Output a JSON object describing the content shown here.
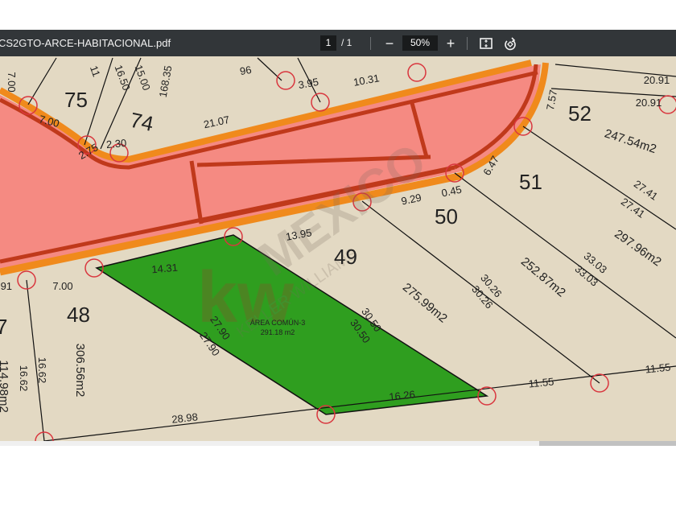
{
  "toolbar": {
    "filename": "CS2GTO-ARCE-HABITACIONAL.pdf",
    "page_current": "1",
    "page_total": "/ 1",
    "zoom_out": "−",
    "zoom_level": "50%",
    "zoom_in": "+",
    "fit_icon": "fit-page-icon",
    "rotate_icon": "rotate-icon"
  },
  "colors": {
    "toolbar": "#323639",
    "lot": "#e3d9c3",
    "road": "#f58a82",
    "curb": "#f08a1c",
    "roadline": "#c0391b",
    "common_area": "#2f9e1f",
    "marker": "#d9363e"
  },
  "watermark": {
    "brand": "MEXICO",
    "sub": "KELLER WILLIAMS"
  },
  "plan": {
    "lots": [
      "75",
      "74",
      "52",
      "51",
      "50",
      "49",
      "48",
      "7"
    ],
    "common_area": {
      "name": "ÁREA COMÚN-3",
      "area": "291.18 m2"
    },
    "dims": [
      "7.00",
      "11",
      "16.50",
      "15.00",
      "168.35",
      "96",
      "3.95",
      "10.31",
      "20.91",
      "20.91",
      "7.57",
      "247.54m2",
      "21.07",
      "7.00",
      "2.30",
      "2.75",
      "6.47",
      "9.29",
      "0.45",
      "27.41",
      "27.41",
      "297.96m2",
      "13.95",
      "14.31",
      "7.00",
      "33.03",
      "33.03",
      "252.87m2",
      "30.26",
      "30.26",
      "275.99m2",
      "30.50",
      "30.50",
      "27.90",
      "27.90",
      "16.26",
      "11.55",
      "11.55",
      "28.98",
      "306.56m2",
      "16.62",
      "16.62",
      "114.98m2",
      ".91"
    ]
  }
}
